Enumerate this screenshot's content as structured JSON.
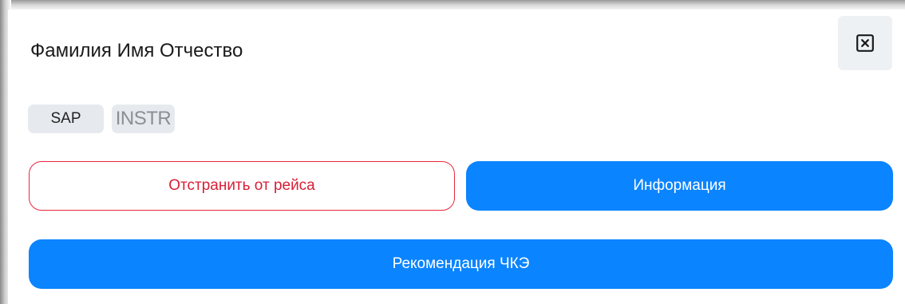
{
  "modal": {
    "title": "Фамилия Имя Отчество",
    "close_icon": "close-square-icon"
  },
  "tags": [
    {
      "label": "SAP"
    },
    {
      "label": "INSTR"
    }
  ],
  "actions": {
    "remove_label": "Отстранить от рейса",
    "info_label": "Информация",
    "recommend_label": "Рекомендация ЧКЭ"
  },
  "colors": {
    "primary": "#0a84ff",
    "danger": "#e8283f",
    "tag_bg": "#e6eaee",
    "close_bg": "#eef1f4"
  }
}
